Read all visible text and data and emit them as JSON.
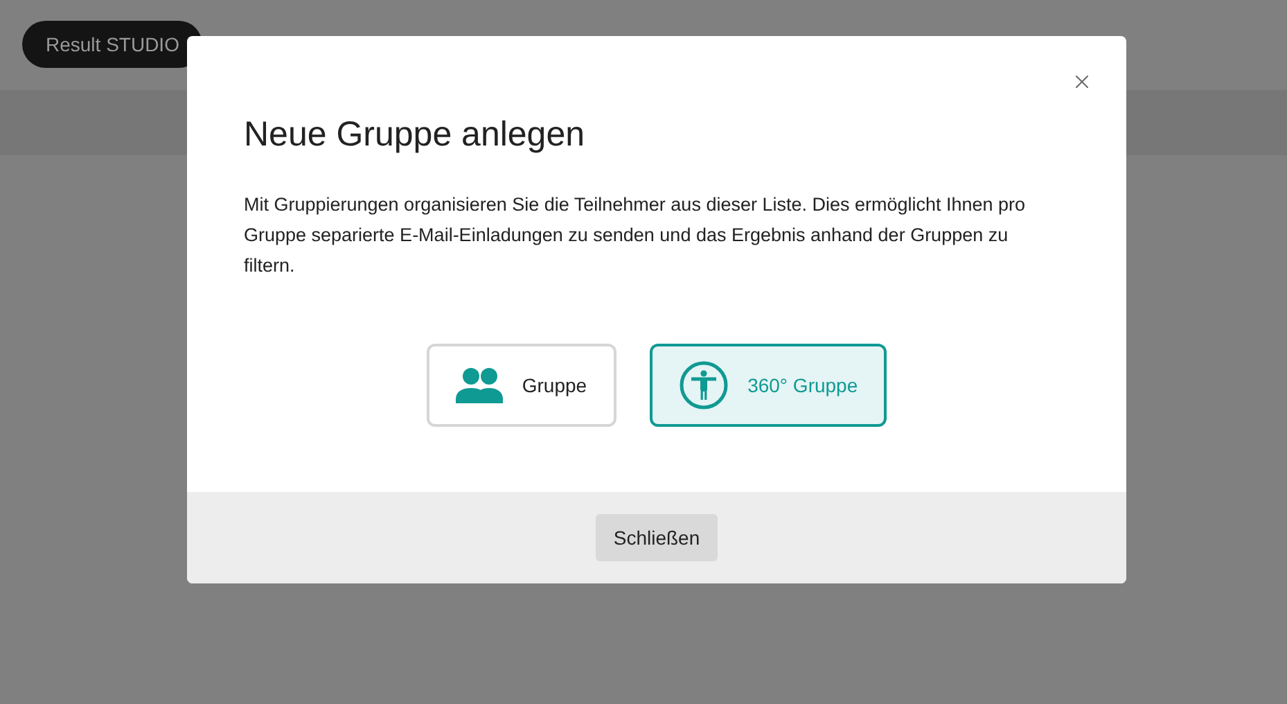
{
  "brand": "Result STUDIO",
  "dialog": {
    "title": "Neue Gruppe anlegen",
    "description": "Mit Gruppierungen organisieren Sie die Teilnehmer aus dieser Liste. Dies ermöglicht Ihnen pro Gruppe separierte E-Mail-Einladungen zu senden und das Ergebnis anhand der Gruppen zu filtern.",
    "options": [
      {
        "kind": "group",
        "label": "Gruppe",
        "selected": false
      },
      {
        "kind": "person",
        "label": "360° Gruppe",
        "selected": true
      }
    ],
    "close_button": "Schließen"
  }
}
